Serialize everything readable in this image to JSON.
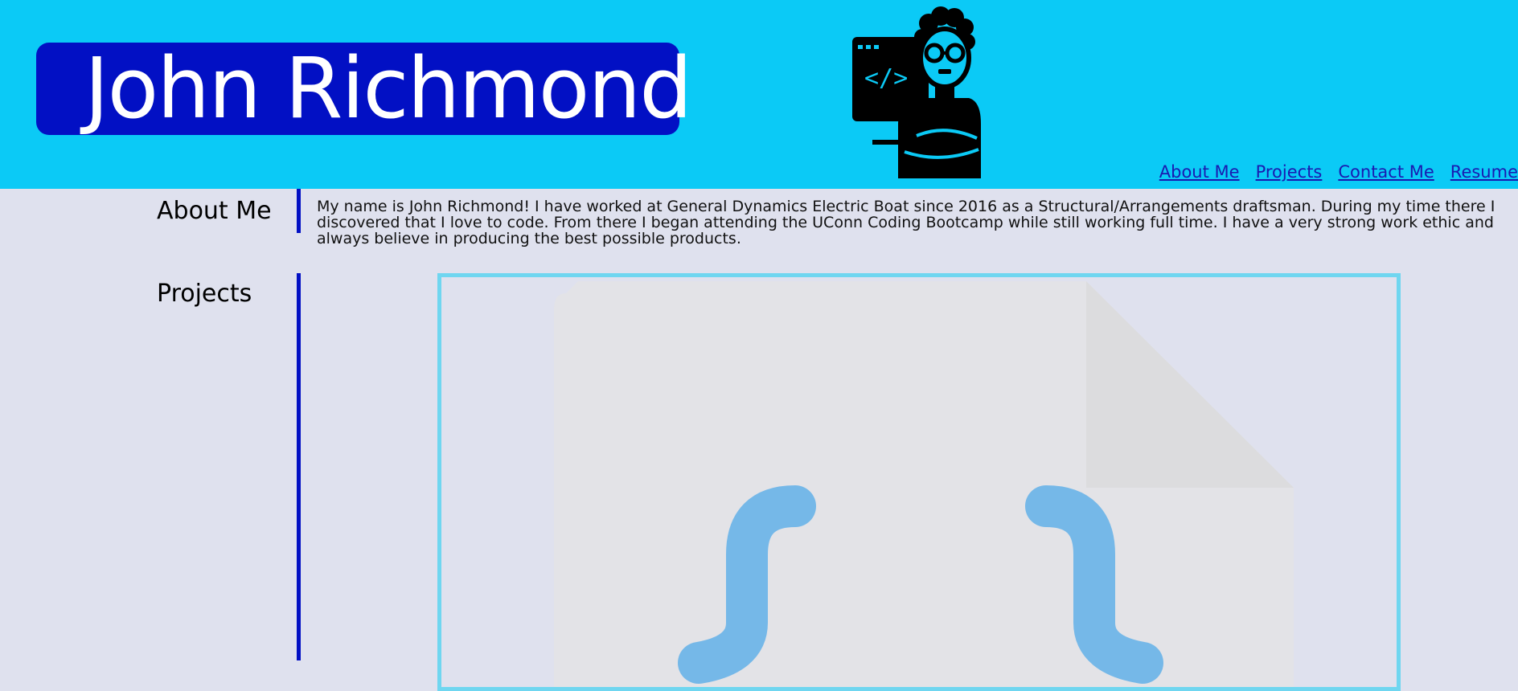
{
  "header": {
    "name": "John Richmond",
    "avatar_icon": "developer-avatar-icon",
    "background_color": "#0bcaf6",
    "name_box_color": "#0210c4"
  },
  "nav": {
    "items": [
      {
        "label": "About Me"
      },
      {
        "label": "Projects"
      },
      {
        "label": "Contact Me"
      },
      {
        "label": "Resume"
      }
    ]
  },
  "about": {
    "title": "About Me",
    "text": "My name is John Richmond! I have worked at General Dynamics Electric Boat since 2016 as a Structural/Arrangements draftsman. During my time there I discovered that I love to code. From there I began attending the UConn Coding Bootcamp while still working full time. I have a very strong work ethic and always believe in producing the best possible products."
  },
  "projects": {
    "title": "Projects",
    "image_icon": "code-file-placeholder-icon",
    "frame_color": "#6fd6f0"
  }
}
